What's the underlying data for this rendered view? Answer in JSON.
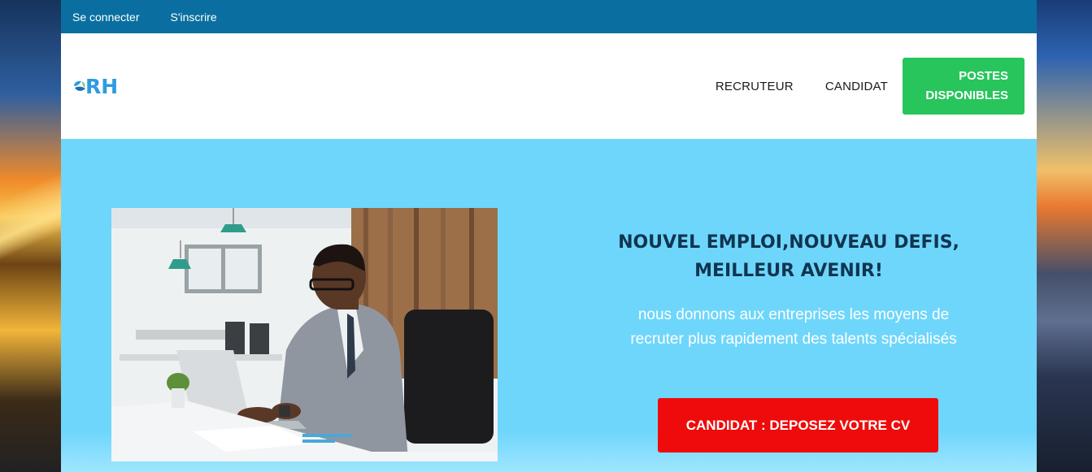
{
  "topbar": {
    "login": "Se connecter",
    "register": "S'inscrire"
  },
  "logo": {
    "text": "RH",
    "color": "#2e9be0"
  },
  "nav": {
    "items": [
      "RECRUTEUR",
      "CANDIDAT"
    ],
    "cta_line1": "POSTES",
    "cta_line2": "DISPONIBLES"
  },
  "hero": {
    "headline_line1": "NOUVEL EMPLOI,NOUVEAU DEFIS,",
    "headline_line2": "MEILLEUR AVENIR!",
    "subtext_line1": "nous donnons aux entreprises les moyens de",
    "subtext_line2": "recruter plus rapidement des talents spécialisés",
    "cta": "CANDIDAT : DEPOSEZ VOTRE CV"
  },
  "colors": {
    "topbar": "#0a6fa0",
    "hero_bg": "#6fd6fb",
    "cta_green": "#27c55c",
    "cta_red": "#ef0b0b",
    "headline": "#0f3550"
  },
  "icons": {
    "logo_leaf": "leaf-icon",
    "photo": "man-at-laptop-photo"
  }
}
